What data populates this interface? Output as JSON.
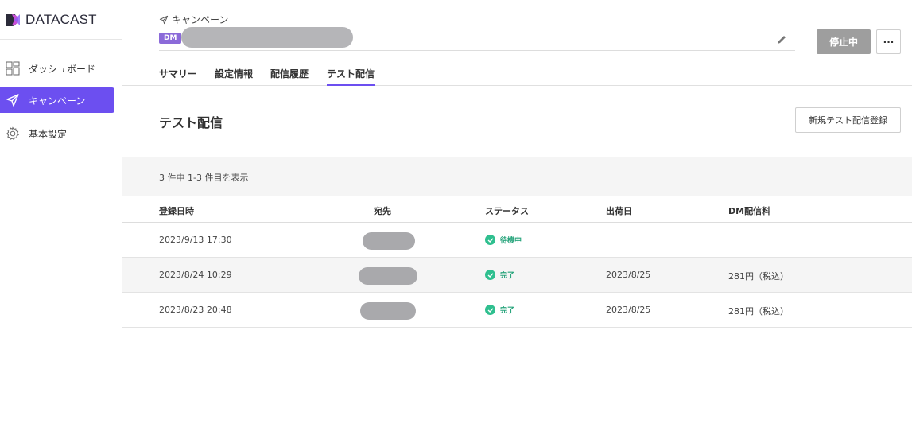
{
  "brand": {
    "name": "DATACAST"
  },
  "sidebar": {
    "items": [
      {
        "label": "ダッシュボード",
        "icon": "dashboard-icon"
      },
      {
        "label": "キャンペーン",
        "icon": "paper-plane-icon",
        "active": true
      },
      {
        "label": "基本設定",
        "icon": "gear-icon"
      }
    ]
  },
  "header": {
    "breadcrumb": "キャンペーン",
    "badge": "DM",
    "status_button": "停止中",
    "more_button": "···"
  },
  "tabs": [
    {
      "label": "サマリー"
    },
    {
      "label": "設定情報"
    },
    {
      "label": "配信履歴"
    },
    {
      "label": "テスト配信",
      "active": true
    }
  ],
  "main": {
    "title": "テスト配信",
    "new_button": "新規テスト配信登録",
    "count_text": "3 件中 1-3 件目を表示"
  },
  "table": {
    "columns": [
      "登録日時",
      "宛先",
      "ステータス",
      "出荷日",
      "DM配信料"
    ],
    "rows": [
      {
        "registered": "2023/9/13 17:30",
        "status": "待機中",
        "ship_date": "",
        "fee": ""
      },
      {
        "registered": "2023/8/24 10:29",
        "status": "完了",
        "ship_date": "2023/8/25",
        "fee": "281円（税込）"
      },
      {
        "registered": "2023/8/23 20:48",
        "status": "完了",
        "ship_date": "2023/8/25",
        "fee": "281円（税込）"
      }
    ]
  },
  "colors": {
    "accent": "#6c4ff0",
    "success": "#2fbf8f",
    "badge": "#8b6ad9"
  }
}
